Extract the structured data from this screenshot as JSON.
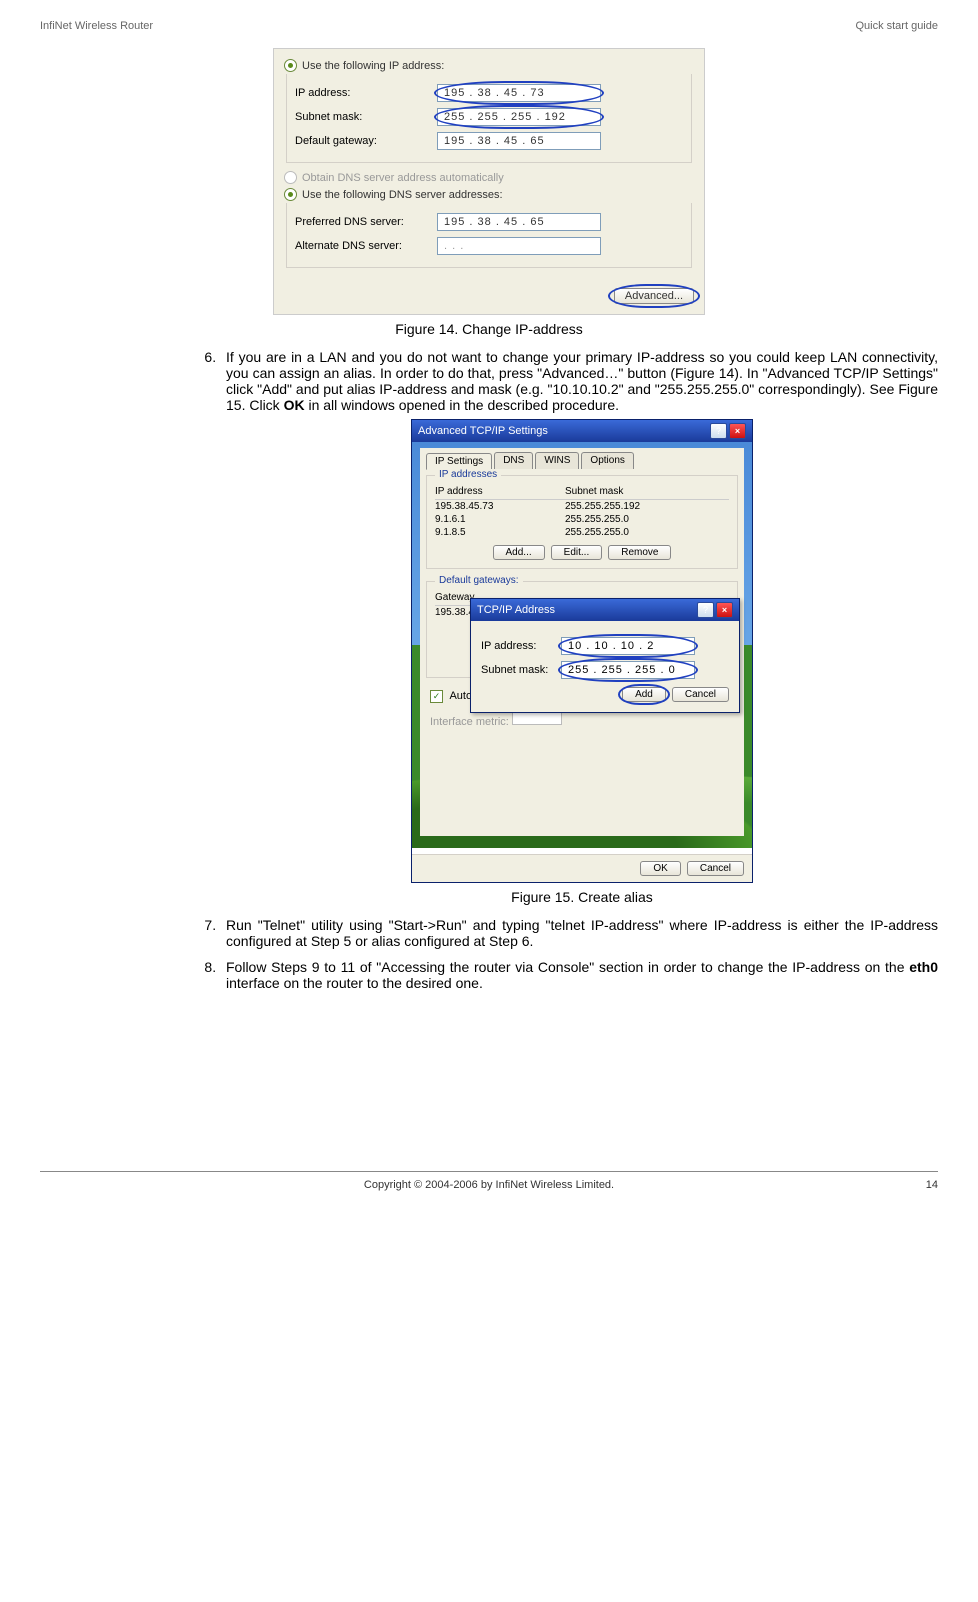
{
  "header": {
    "left": "InfiNet Wireless Router",
    "right": "Quick start guide"
  },
  "fig1": {
    "radio1": "Use the following IP address:",
    "ip_label": "IP address:",
    "ip_value": "195 .  38  .  45  .  73",
    "mask_label": "Subnet mask:",
    "mask_value": "255 . 255 . 255 . 192",
    "gw_label": "Default gateway:",
    "gw_value": "195 .  38  .  45  .  65",
    "radio_off": "Obtain DNS server address automatically",
    "radio2": "Use the following DNS server addresses:",
    "pref_label": "Preferred DNS server:",
    "pref_value": "195 .  38  .  45  .  65",
    "alt_label": "Alternate DNS server:",
    "alt_value": ".        .        .",
    "adv_btn": "Advanced...",
    "caption": "Figure 14. Change IP-address"
  },
  "step6": {
    "num": "6",
    "text_a": "If you are in a LAN and you do not want to change your primary IP-address so you could keep LAN connectivity, you can assign an alias. In order to do that, press \"Advanced…\" button (Figure 14). In \"Advanced TCP/IP Settings\" click \"Add\" and put alias IP-address and mask (e.g. \"10.10.10.2\" and \"255.255.255.0\" correspondingly). See Figure 15. Click ",
    "ok": "OK",
    "text_b": " in all windows opened in the described procedure."
  },
  "fig2": {
    "title": "Advanced TCP/IP Settings",
    "tabs": [
      "IP Settings",
      "DNS",
      "WINS",
      "Options"
    ],
    "group_ip": "IP addresses",
    "head_ip": "IP address",
    "head_mask": "Subnet mask",
    "rows": [
      {
        "ip": "195.38.45.73",
        "mask": "255.255.255.192"
      },
      {
        "ip": "9.1.6.1",
        "mask": "255.255.255.0"
      },
      {
        "ip": "9.1.8.5",
        "mask": "255.255.255.0"
      }
    ],
    "btn_add": "Add...",
    "btn_edit": "Edit...",
    "btn_remove": "Remove",
    "group_gw": "Default gateways:",
    "gw_head": "Gateway",
    "gw_row": "195.38.45.65",
    "autometric": "Automatic metric",
    "ifmetric": "Interface metric:",
    "ok": "OK",
    "cancel": "Cancel",
    "modal": {
      "title": "TCP/IP Address",
      "ip_label": "IP address:",
      "ip_value": "10  .  10  .  10  .   2",
      "mask_label": "Subnet mask:",
      "mask_value": "255 . 255 . 255 .   0",
      "add": "Add",
      "cancel": "Cancel"
    },
    "caption": "Figure 15. Create alias"
  },
  "step7": {
    "text": "Run \"Telnet\" utility using \"Start->Run\" and typing \"telnet IP-address\" where IP-address is either the IP-address configured at Step 5 or alias configured at Step 6."
  },
  "step8": {
    "text_a": "Follow Steps 9 to 11 of \"Accessing the router via Console\" section in order to change the IP-address on the ",
    "eth": "eth0",
    "text_b": " interface on the router to the desired one."
  },
  "footer": {
    "copy": "Copyright © 2004-2006 by InfiNet Wireless Limited.",
    "page": "14"
  }
}
